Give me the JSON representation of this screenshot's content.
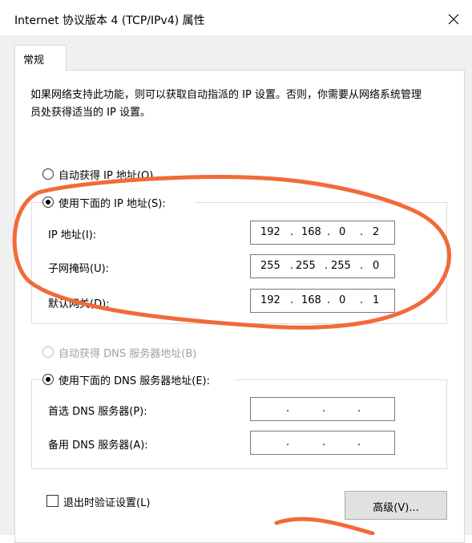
{
  "window": {
    "title": "Internet 协议版本 4 (TCP/IPv4) 属性"
  },
  "tabs": [
    {
      "label": "常规"
    }
  ],
  "description": "如果网络支持此功能，则可以获取自动指派的 IP 设置。否则，你需要从网络系统管理员处获得适当的 IP 设置。",
  "ip_section": {
    "auto_option": "自动获得 IP 地址(O)",
    "manual_option": "使用下面的 IP 地址(S):",
    "manual_selected": true,
    "fields": [
      {
        "label": "IP 地址(I):",
        "octets": [
          "192",
          "168",
          "0",
          "2"
        ]
      },
      {
        "label": "子网掩码(U):",
        "octets": [
          "255",
          "255",
          "255",
          "0"
        ]
      },
      {
        "label": "默认网关(D):",
        "octets": [
          "192",
          "168",
          "0",
          "1"
        ]
      }
    ]
  },
  "dns_section": {
    "auto_option": "自动获得 DNS 服务器地址(B)",
    "auto_disabled": true,
    "manual_option": "使用下面的 DNS 服务器地址(E):",
    "manual_selected": true,
    "fields": [
      {
        "label": "首选 DNS 服务器(P):",
        "octets": [
          "",
          "",
          "",
          ""
        ]
      },
      {
        "label": "备用 DNS 服务器(A):",
        "octets": [
          "",
          "",
          "",
          ""
        ]
      }
    ]
  },
  "validate_on_exit": {
    "label": "退出时验证设置(L)",
    "checked": false
  },
  "advanced_button": "高级(V)...",
  "icons": {
    "close": "close-icon"
  },
  "colors": {
    "annotation": "#f26a3a",
    "dialog_bg": "#f0f0f0"
  }
}
